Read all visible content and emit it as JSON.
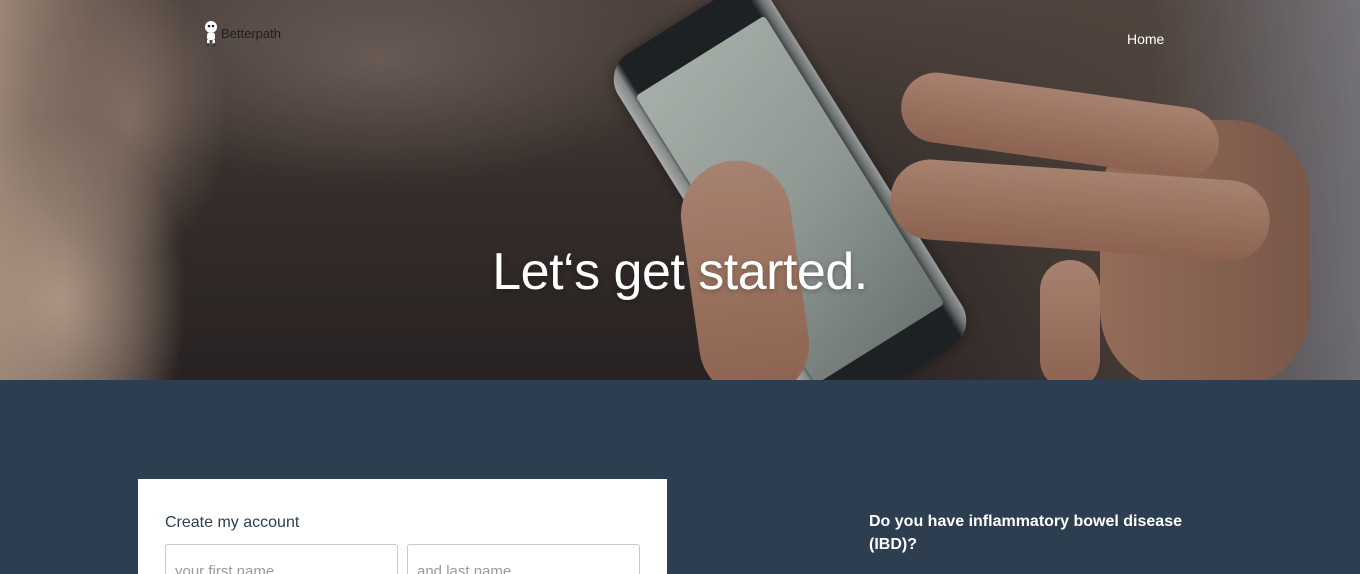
{
  "header": {
    "logo_text": "Betterpath",
    "logo_icon": "robot-mascot-icon",
    "nav": {
      "home_label": "Home"
    }
  },
  "hero": {
    "title": "Let‘s get started."
  },
  "signup_form": {
    "title": "Create my account",
    "first_name_placeholder": "your first name",
    "last_name_placeholder": "and last name"
  },
  "ibd": {
    "question": "Do you have inflammatory bowel disease (IBD)?"
  },
  "colors": {
    "content_background": "#2c3e50",
    "card_background": "#ffffff",
    "hero_text": "#ffffff"
  }
}
